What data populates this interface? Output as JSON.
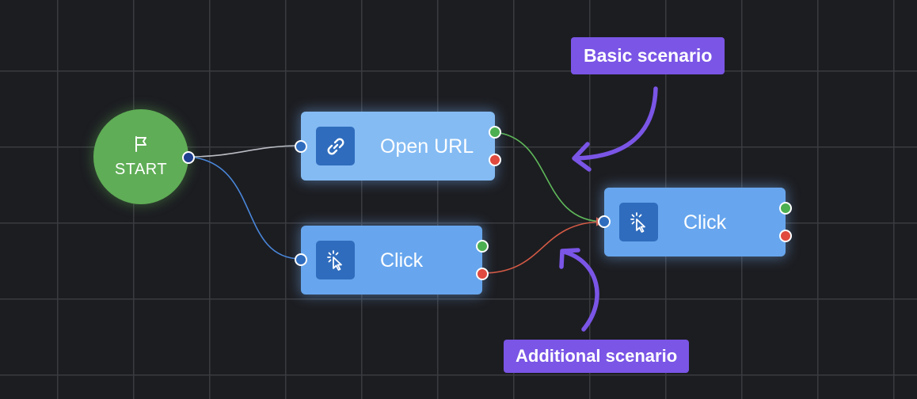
{
  "start_node": {
    "label": "START",
    "icon": "flag-icon",
    "color": "#5fad56"
  },
  "nodes": [
    {
      "id": "open-url",
      "title": "Open URL",
      "icon": "link-icon"
    },
    {
      "id": "click-1",
      "title": "Click",
      "icon": "cursor-click-icon"
    },
    {
      "id": "click-2",
      "title": "Click",
      "icon": "cursor-click-icon"
    }
  ],
  "callouts": {
    "basic": "Basic scenario",
    "additional": "Additional scenario"
  },
  "colors": {
    "background": "#1c1d21",
    "grid": "#3a3b40",
    "node_light": "#84bbf3",
    "node": "#67a6ee",
    "icon_box": "#2f6cbd",
    "success_port": "#4caf50",
    "error_port": "#e04a3f",
    "callout": "#7a55e6",
    "wire_default": "#b9bcc4",
    "wire_blue": "#4a87db",
    "wire_green": "#5fb85a",
    "wire_red": "#d55a45"
  }
}
